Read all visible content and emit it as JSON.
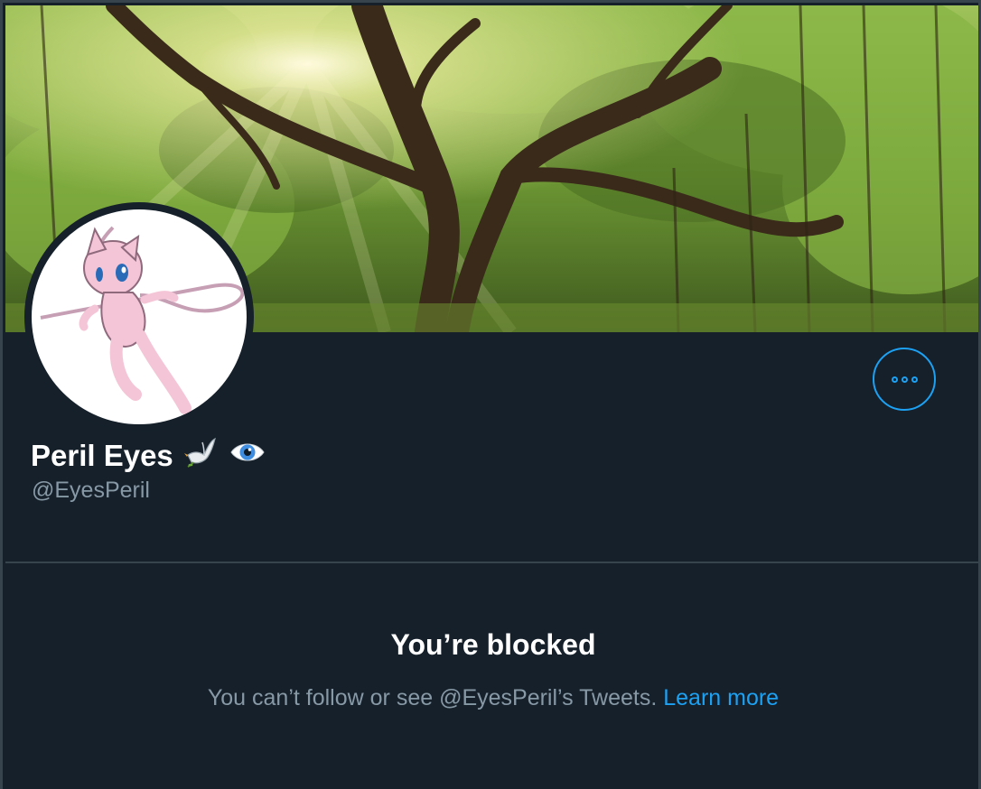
{
  "profile": {
    "display_name": "Peril Eyes",
    "handle": "@EyesPeril",
    "name_emojis": [
      "dove-emoji",
      "eye-emoji"
    ]
  },
  "actions": {
    "more_icon": "more-horizontal-icon"
  },
  "blocked": {
    "title": "You’re blocked",
    "message": "You can’t follow or see @EyesPeril’s Tweets.",
    "link_label": "Learn more"
  },
  "colors": {
    "background": "#15202b",
    "accent": "#1da1f2",
    "secondary_text": "#8899a6",
    "border": "#38444d"
  }
}
